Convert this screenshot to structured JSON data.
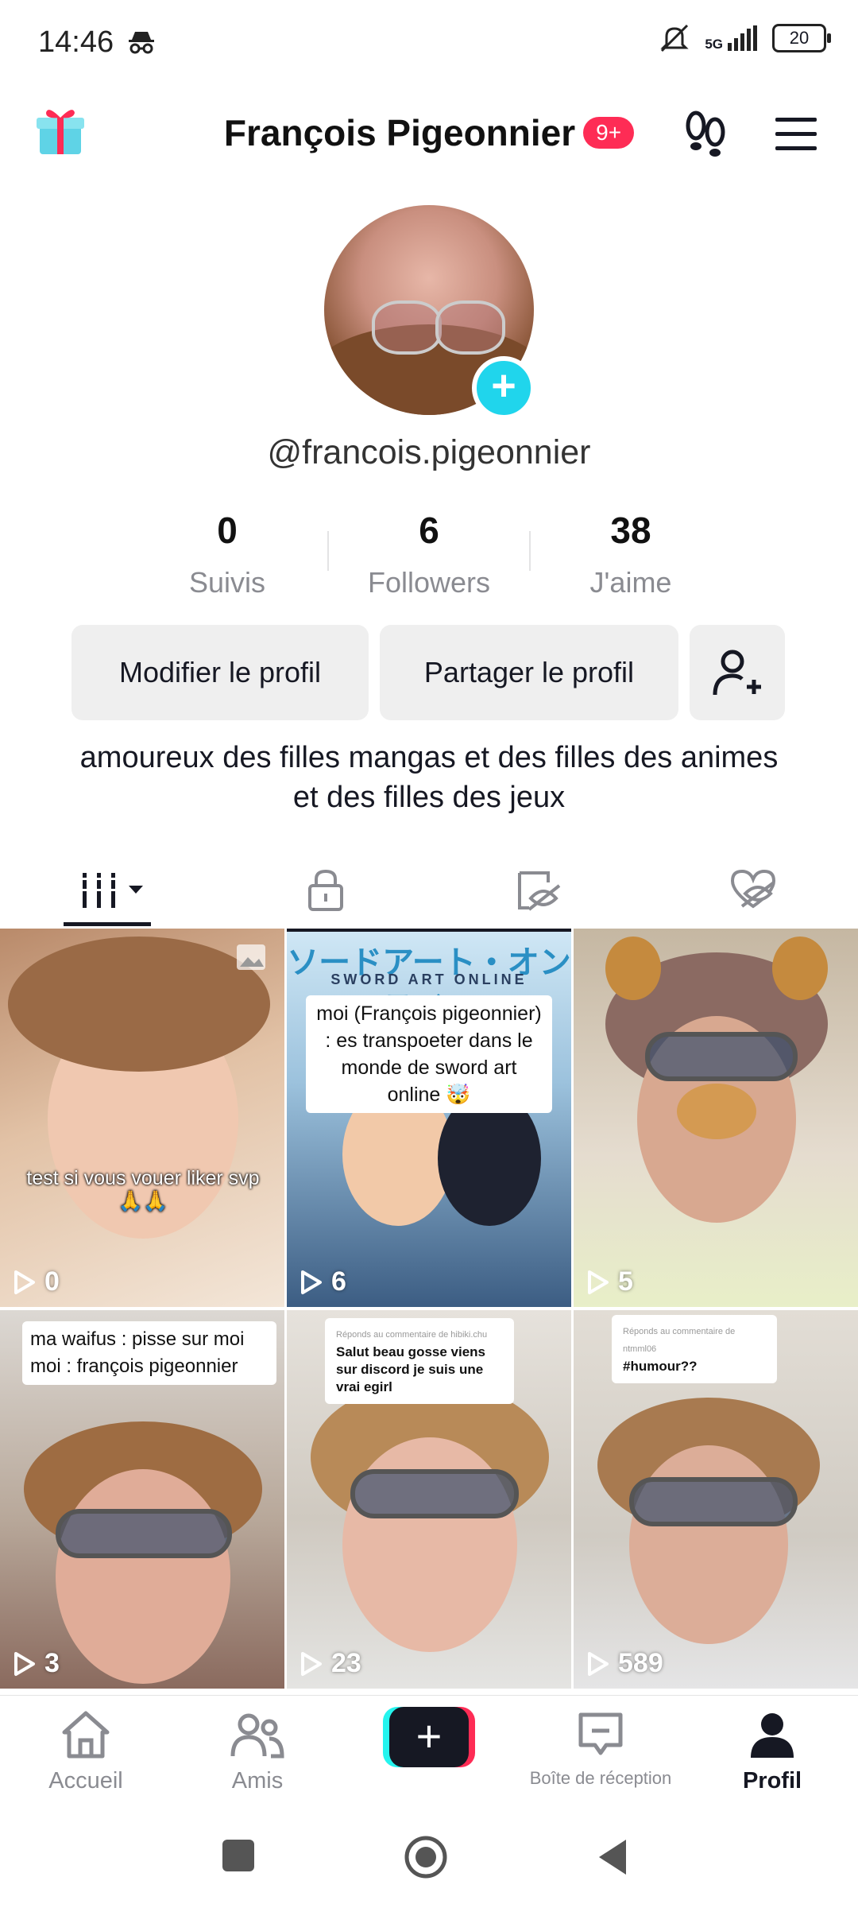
{
  "status_bar": {
    "time": "14:46",
    "network": "5G",
    "battery": "20"
  },
  "header": {
    "title": "François Pigeonnier",
    "badge": "9+"
  },
  "profile": {
    "username": "@francois.pigeonnier"
  },
  "stats": [
    {
      "value": "0",
      "label": "Suivis"
    },
    {
      "value": "6",
      "label": "Followers"
    },
    {
      "value": "38",
      "label": "J'aime"
    }
  ],
  "buttons": {
    "edit": "Modifier le profil",
    "share": "Partager le profil"
  },
  "bio": "amoureux des filles mangas et des filles des animes et des filles des jeux",
  "videos": [
    {
      "views": "0",
      "overlay": "test si vous vouer liker svp 🙏🙏"
    },
    {
      "views": "6",
      "title_jp": "ソードアート・オンライン",
      "title_en": "SWORD ART ONLINE",
      "caption": "moi (François pigeonnier) : es transpoeter dans le monde de sword art online 🤯"
    },
    {
      "views": "5"
    },
    {
      "views": "3",
      "caption": "ma waifus : pisse sur moi moi : françois pigeonnier"
    },
    {
      "views": "23",
      "reply_header": "Réponds au commentaire de hibiki.chu",
      "comment": "Salut beau gosse viens sur discord je suis une vrai egirl"
    },
    {
      "views": "589",
      "reply_header": "Réponds au commentaire de ntmml06",
      "comment": "#humour??"
    }
  ],
  "nav": {
    "home": "Accueil",
    "friends": "Amis",
    "inbox": "Boîte de réception",
    "profile": "Profil"
  }
}
